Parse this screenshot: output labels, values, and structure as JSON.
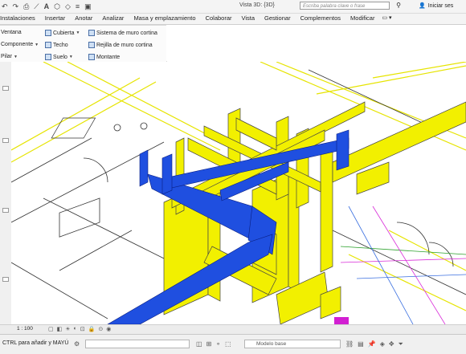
{
  "quick_access": {
    "icons": [
      "undo-icon",
      "redo-icon",
      "print-icon",
      "measure-icon",
      "text-A-icon",
      "3d-view-icon"
    ],
    "window_title": "Vista 3D: {3D}",
    "search_placeholder": "Escriba palabra clave o frase",
    "user_label": "Iniciar ses"
  },
  "ribbon_tabs": [
    "Instalaciones",
    "Insertar",
    "Anotar",
    "Analizar",
    "Masa y emplazamiento",
    "Colaborar",
    "Vista",
    "Gestionar",
    "Complementos",
    "Modificar"
  ],
  "ribbon_buttons": {
    "col1": [
      "Ventana",
      "Componente",
      "Pilar"
    ],
    "col2": [
      "Cubierta",
      "Techo",
      "Suelo"
    ],
    "col3": [
      "Sistema de muro cortina",
      "Rejilla de muro cortina",
      "Montante"
    ]
  },
  "view_bar": {
    "scale": "1 : 100"
  },
  "status_bar": {
    "hint": "CTRL para añadir y MAYÚ",
    "model": "Modelo base"
  },
  "colors": {
    "duct_yellow": "#f2f000",
    "pipe_blue": "#1f4fe0",
    "floor_line_yellow": "#e8e600",
    "selection_magenta": "#d21fd2"
  }
}
